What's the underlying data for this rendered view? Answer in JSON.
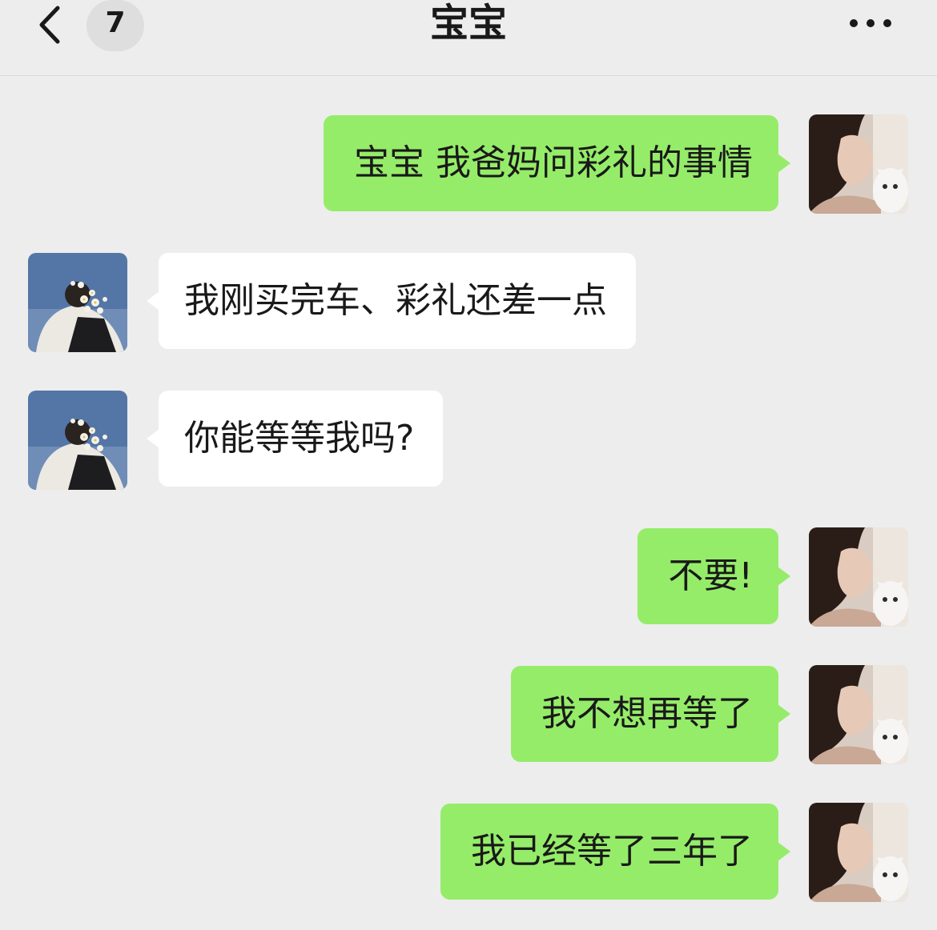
{
  "header": {
    "back_icon": "chevron-left-icon",
    "unread_count": "7",
    "title": "宝宝",
    "more_icon": "more-dots-icon"
  },
  "colors": {
    "background": "#ededed",
    "sent_bubble": "#95ec69",
    "received_bubble": "#ffffff",
    "badge": "#dedede"
  },
  "messages": [
    {
      "side": "right",
      "text": "宝宝 我爸妈问彩礼的事情"
    },
    {
      "side": "left",
      "text": "我刚买完车、彩礼还差一点"
    },
    {
      "side": "left",
      "text": "你能等等我吗?"
    },
    {
      "side": "right",
      "text": "不要!"
    },
    {
      "side": "right",
      "text": "我不想再等了"
    },
    {
      "side": "right",
      "text": "我已经等了三年了"
    }
  ]
}
